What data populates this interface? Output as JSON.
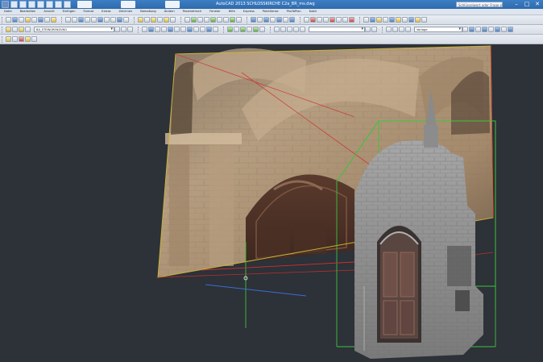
{
  "titlebar": {
    "title": "AutoCAD 2013   SCHLOSSKIRCHE   C2a_BR_ms.dwg",
    "search_placeholder": "Schlüsselwort oder Frage eingeben",
    "minimize": "–",
    "maximize": "□",
    "close": "✕"
  },
  "menu": {
    "items": [
      "Datei",
      "Bearbeiten",
      "Ansicht",
      "Einfügen",
      "Format",
      "Extras",
      "Zeichnen",
      "Bemaßung",
      "Ändern",
      "Parametrisch",
      "Fenster",
      "Hilfe",
      "Express",
      "PointSense",
      "PhoToPlan",
      "Kubit"
    ]
  },
  "toolbar": {
    "layer_combo": "BA_STEINGRENZUNG",
    "visual_style_combo": "Vorlage"
  },
  "viewport": {
    "photo_description_color": "#b49a7c",
    "point_cloud_color": "#9b9b9b",
    "frame_color_yellow": "#c8b23a",
    "frame_color_green": "#3cc43c",
    "axis_red": "#d03030",
    "axis_blue": "#3a6fd0"
  }
}
